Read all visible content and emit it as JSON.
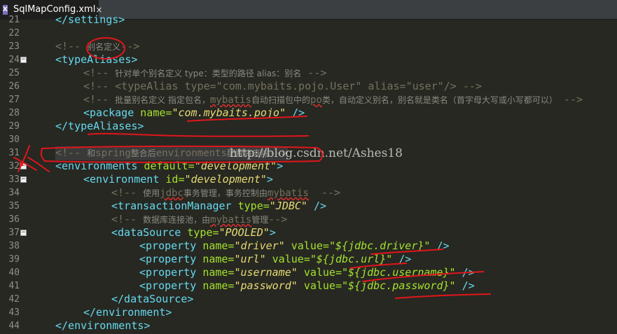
{
  "tab": {
    "icon_name": "xml-file-icon",
    "icon_text": "X",
    "title": "SqlMapConfig.xml",
    "close_symbol": "×"
  },
  "watermark": "http://blog.csdn.net/Ashes18",
  "lines": [
    {
      "n": "21"
    },
    {
      "n": "22"
    },
    {
      "n": "23"
    },
    {
      "n": "24"
    },
    {
      "n": "25"
    },
    {
      "n": "26"
    },
    {
      "n": "27"
    },
    {
      "n": "28"
    },
    {
      "n": "29"
    },
    {
      "n": "30"
    },
    {
      "n": "31"
    },
    {
      "n": "32"
    },
    {
      "n": "33"
    },
    {
      "n": "34"
    },
    {
      "n": "35"
    },
    {
      "n": "36"
    },
    {
      "n": "37"
    },
    {
      "n": "38"
    },
    {
      "n": "39"
    },
    {
      "n": "40"
    },
    {
      "n": "41"
    },
    {
      "n": "42"
    },
    {
      "n": "43"
    },
    {
      "n": "44"
    }
  ],
  "code": {
    "l21": {
      "close_settings": "</settings>"
    },
    "l23": {
      "open": "<!--",
      "text": "别名定义",
      "close": "-->"
    },
    "l24": {
      "tag": "<typeAliases>"
    },
    "l25": {
      "open": "<!--",
      "text": "针对单个别名定义 type：类型的路径 alias：别名",
      "close": "-->"
    },
    "l26": {
      "text": "<!-- <typeAlias type=\"com.mybaits.pojo.User\" alias=\"user\"/> -->"
    },
    "l27": {
      "open": "<!--",
      "t1": "批量别名定义 指定包名，",
      "t2": "mybatis",
      "t3": "自动扫描包中的",
      "t4": "po",
      "t5": "类，自动定义别名，别名就是类名（首字母大写或小写都可以）",
      "close": "-->"
    },
    "l28": {
      "tag": "<package",
      "attr": "name=",
      "val": "\"com.mybaits.pojo\"",
      "end": "/>"
    },
    "l29": {
      "tag": "</typeAliases>"
    },
    "l31": {
      "open": "<!--",
      "t1": "和",
      "t2": "spring",
      "t3": "整合后",
      "t4": "environments",
      "t5": "配置将废除",
      "close": "-->"
    },
    "l32": {
      "tag": "<environments",
      "attr": "default=",
      "val": "\"development\"",
      "end": ">"
    },
    "l33": {
      "tag": "<environment",
      "attr": "id=",
      "val": "\"development\"",
      "end": ">"
    },
    "l34": {
      "open": "<!--",
      "t1": "使用",
      "t2": "jdbc",
      "t3": "事务管理，事务控制由",
      "t4": "mybatis",
      "close": "-->"
    },
    "l35": {
      "tag": "<transactionManager",
      "attr": "type=",
      "val": "\"JDBC\"",
      "end": "/>"
    },
    "l36": {
      "open": "<!--",
      "t1": "数据库连接池，由",
      "t2": "mybatis",
      "t3": "管理",
      "close": "-->"
    },
    "l37": {
      "tag": "<dataSource",
      "attr": "type=",
      "val": "\"POOLED\"",
      "end": ">"
    },
    "l38": {
      "tag": "<property",
      "attr1": "name=",
      "val1": "\"driver\"",
      "attr2": "value=",
      "val2": "\"${jdbc.driver}\"",
      "end": "/>"
    },
    "l39": {
      "tag": "<property",
      "attr1": "name=",
      "val1": "\"url\"",
      "attr2": "value=",
      "val2": "\"${jdbc.url}\"",
      "end": "/>"
    },
    "l40": {
      "tag": "<property",
      "attr1": "name=",
      "val1": "\"username\"",
      "attr2": "value=",
      "val2": "\"${jdbc.username}\"",
      "end": "/>"
    },
    "l41": {
      "tag": "<property",
      "attr1": "name=",
      "val1": "\"password\"",
      "attr2": "value=",
      "val2": "\"${jdbc.password}\"",
      "end": "/>"
    },
    "l42": {
      "tag": "</dataSource>"
    },
    "l43": {
      "tag": "</environment>"
    },
    "l44": {
      "tag": "</environments>"
    }
  }
}
